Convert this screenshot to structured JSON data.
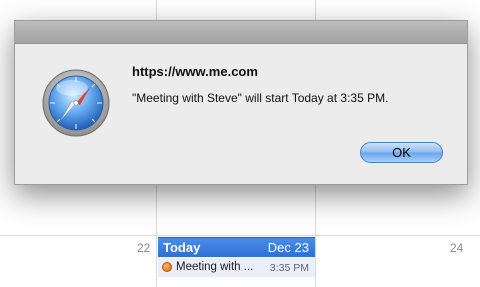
{
  "calendar": {
    "day_numbers": [
      "22",
      "24"
    ],
    "today": {
      "label": "Today",
      "date": "Dec 23",
      "event": {
        "title": "Meeting with ...",
        "time": "3:35 PM"
      }
    }
  },
  "alert": {
    "title": "https://www.me.com",
    "message": "\"Meeting with Steve\" will start Today at 3:35 PM.",
    "ok_label": "OK",
    "icon": "safari-compass-icon"
  },
  "colors": {
    "today_header": "#2f6fd6",
    "event_dot": "#e06a00",
    "ok_button": "#6aa5ec"
  }
}
